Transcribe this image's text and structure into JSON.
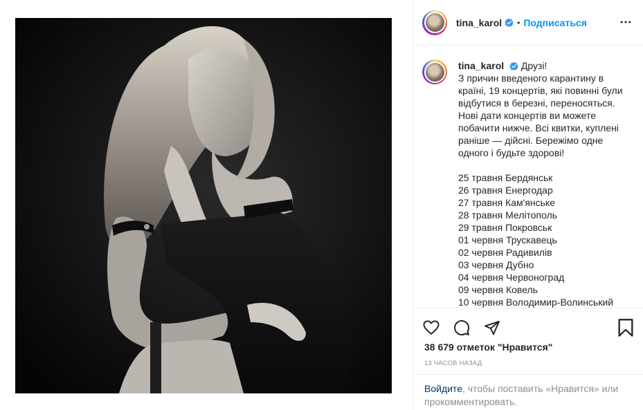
{
  "post": {
    "username": "tina_karol",
    "follow_label": "Подписаться",
    "separator": "•"
  },
  "caption": {
    "lines": [
      "Друзі!",
      "З причин введеного карантину в країні, 19 концертів, які повинні були відбутися в березні, переносяться. Нові дати концертів ви можете побачити нижче. Всі квитки, куплені раніше — дійсні. Бережімо одне одного і будьте здорові!"
    ],
    "dates": [
      "25 травня Бердянськ",
      "26 травня Енергодар",
      "27 травня Кам'янське",
      "28 травня Мелітополь",
      "29 травня Покровськ",
      "01 червня Трускавець",
      "02 червня Радивилів",
      "03 червня Дубно",
      "04 червня Червоноград",
      "09 червня Ковель",
      "10 червня Володимир-Волинський"
    ]
  },
  "stats": {
    "likes": "38 679 отметок \"Нравится\"",
    "time": "13 ЧАСОВ НАЗАД"
  },
  "login_prompt": {
    "link": "Войдите",
    "text": ", чтобы поставить «Нравится» или прокомментировать."
  },
  "icons": {
    "like": "heart-icon",
    "comment": "comment-icon",
    "share": "share-icon",
    "save": "bookmark-icon",
    "more": "more-dots-icon",
    "verified": "verified-badge-icon"
  },
  "colors": {
    "accent": "#0095f6",
    "link": "#00376b",
    "muted": "#8e8e8e",
    "text": "#262626",
    "verified": "#3897f0"
  }
}
